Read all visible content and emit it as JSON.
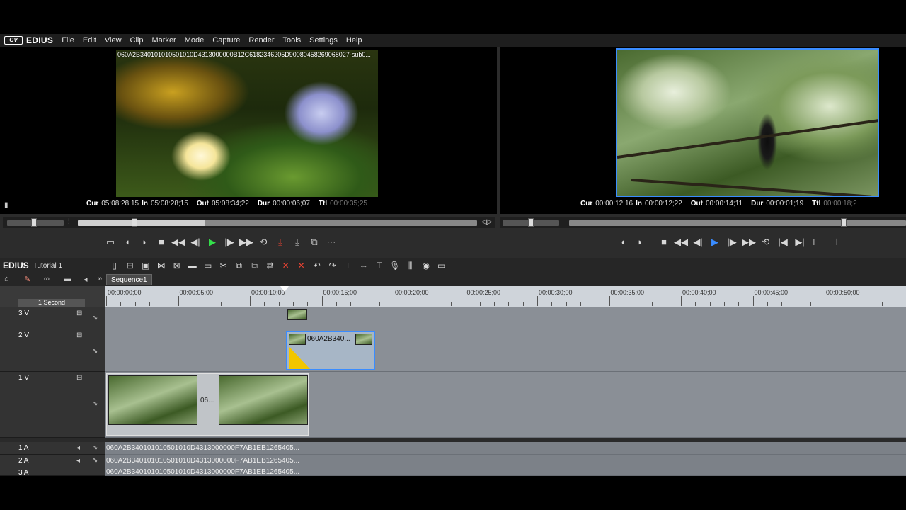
{
  "menu": {
    "logo_mark": "GV",
    "app_name": "EDIUS",
    "items": [
      "File",
      "Edit",
      "View",
      "Clip",
      "Marker",
      "Mode",
      "Capture",
      "Render",
      "Tools",
      "Settings",
      "Help"
    ]
  },
  "player": {
    "clip_name": "060A2B340101010501010D4313000000B12C6182346205D900804582690680​27-sub0...",
    "cur_label": "Cur",
    "cur": "05:08:28;15",
    "in_label": "In",
    "in": "05:08:28;15",
    "out_label": "Out",
    "out": "05:08:34;22",
    "dur_label": "Dur",
    "dur": "00:00:06;07",
    "ttl_label": "Ttl",
    "ttl": "00:00:35;25"
  },
  "recorder": {
    "cur_label": "Cur",
    "cur": "00:00:12;16",
    "in_label": "In",
    "in": "00:00:12;22",
    "out_label": "Out",
    "out": "00:00:14;11",
    "dur_label": "Dur",
    "dur": "00:00:01;19",
    "ttl_label": "Ttl",
    "ttl": "00:00:18;2"
  },
  "timeline": {
    "app_name": "EDIUS",
    "project": "Tutorial 1",
    "sequence_tab": "Sequence1",
    "scale": "1 Second",
    "ruler_labels": [
      "00:00:00;00",
      "00:00:05;00",
      "00:00:10;00",
      "00:00:15;00",
      "00:00:20;00",
      "00:00:25;00",
      "00:00:30;00",
      "00:00:35;00",
      "00:00:40;00",
      "00:00:45;00",
      "00:00:50;00"
    ],
    "tracks": {
      "v3": "3 V",
      "v2": "2 V",
      "v1": "1 V",
      "a1": "1 A",
      "a2": "2 A",
      "a3": "3 A"
    },
    "v2_clip_name": "060A2B340...",
    "v1_clip_label": "06...",
    "audio_clip_name": "060A2B340101010501010D4313000000F7AB1EB1265405..."
  },
  "colors": {
    "play_green": "#33e04a",
    "selection_blue": "#3a8cff",
    "transition_yellow": "#f2c600",
    "playhead_red": "#e53"
  }
}
